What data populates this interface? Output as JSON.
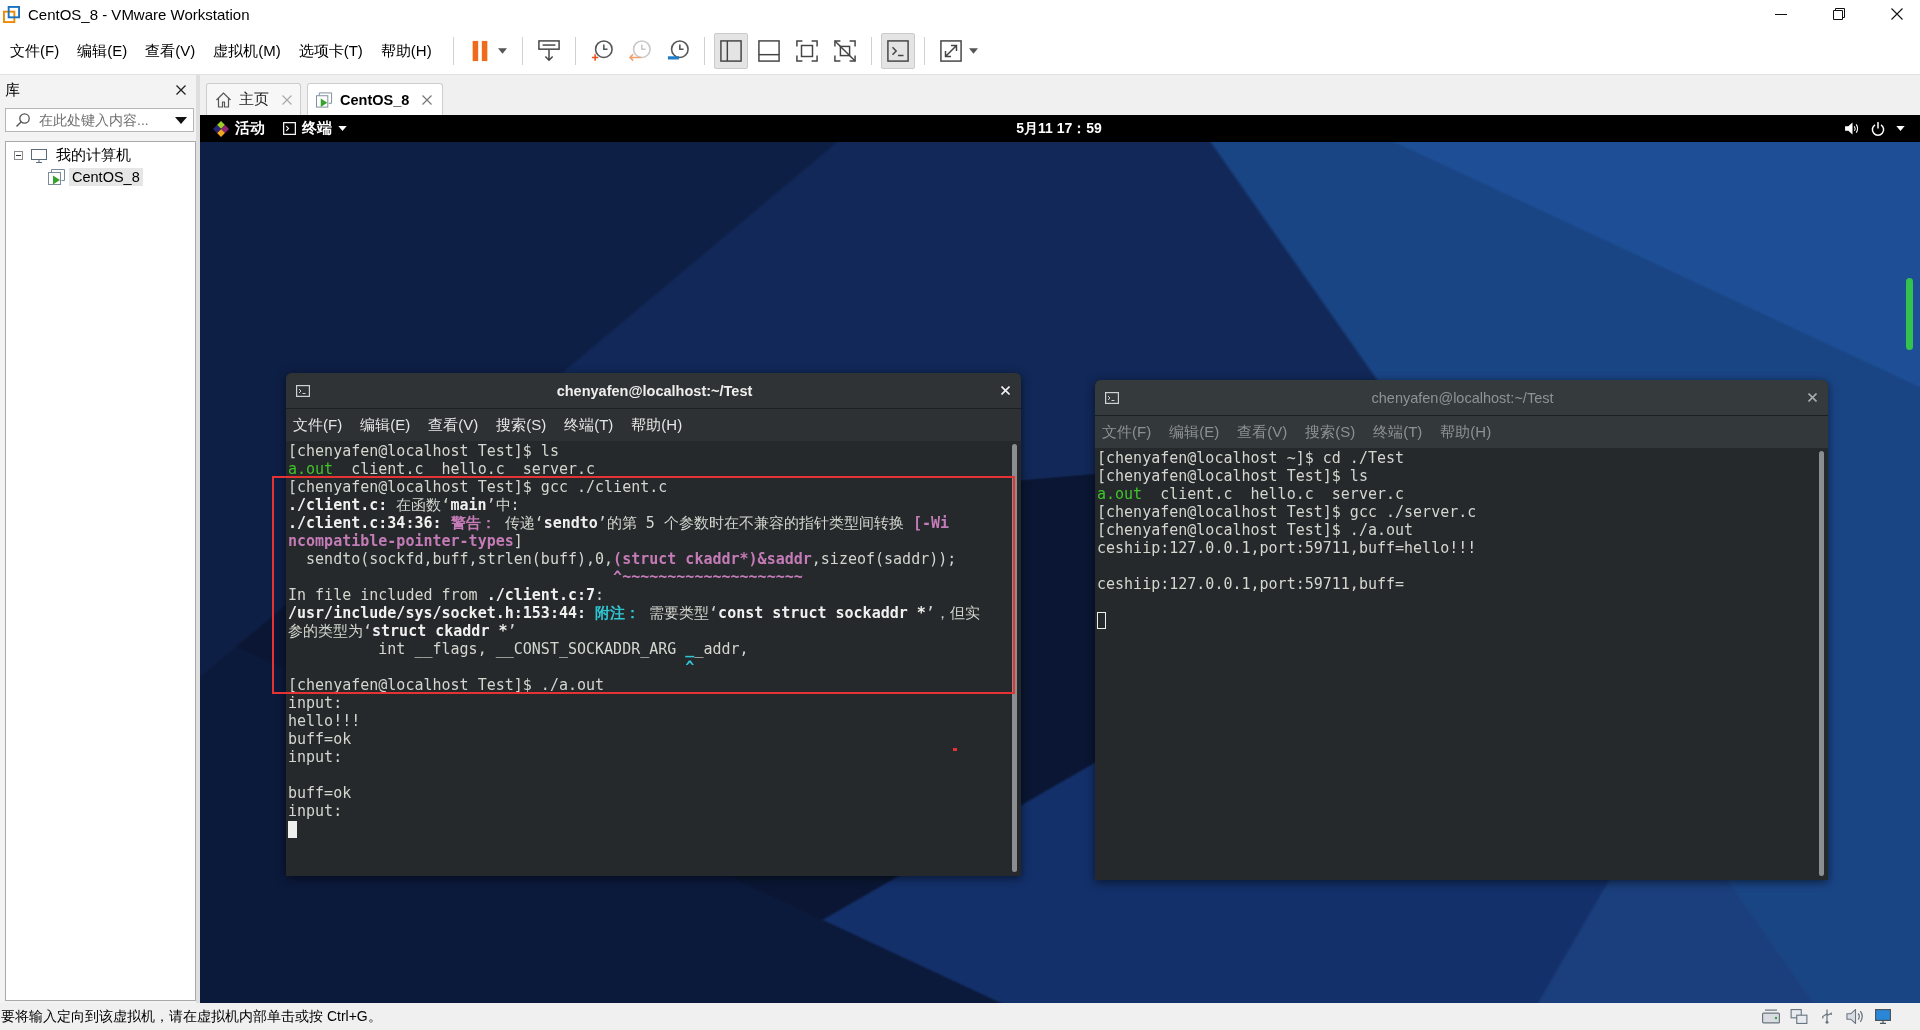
{
  "window": {
    "title": "CentOS_8 - VMware Workstation"
  },
  "menu_bar": [
    "文件(F)",
    "编辑(E)",
    "查看(V)",
    "虚拟机(M)",
    "选项卡(T)",
    "帮助(H)"
  ],
  "toolbar": [
    {
      "pressed": false
    },
    {
      "pressed": false
    },
    {
      "pressed": false
    },
    {
      "pressed": false
    },
    {
      "pressed": false
    },
    {
      "pressed": true
    },
    {
      "pressed": false
    },
    {
      "pressed": false
    },
    {
      "pressed": false
    },
    {
      "pressed": true
    },
    {
      "pressed": false
    }
  ],
  "library": {
    "title": "库",
    "search": {
      "placeholder": "在此处键入内容..."
    },
    "tree": [
      {
        "label": "我的计算机",
        "expanded": true,
        "selected": false,
        "children": [
          {
            "label": "CentOS_8",
            "selected": true
          }
        ]
      }
    ]
  },
  "tabs": [
    {
      "kind": "home",
      "label": "主页",
      "selected": false
    },
    {
      "kind": "vm",
      "label": "CentOS_8",
      "selected": true
    }
  ],
  "guest": {
    "top_bar": {
      "activities": "活动",
      "app_menu": "终端",
      "clock": "5月11 17：59"
    },
    "terminals": [
      {
        "title": "chenyafen@localhost:~/Test",
        "focused": true,
        "menu": [
          "文件(F)",
          "编辑(E)",
          "查看(V)",
          "搜索(S)",
          "终端(T)",
          "帮助(H)"
        ],
        "lines": [
          {
            "kind": "text",
            "spans": [
              {
                "text": "[chenyafen@localhost Test]$ ls",
                "kind": "plain"
              }
            ]
          },
          {
            "kind": "text",
            "spans": [
              {
                "text": "a.out",
                "kind": "executable"
              },
              {
                "text": "  client.c  hello.c  server.c",
                "kind": "plain"
              }
            ]
          },
          {
            "kind": "text",
            "spans": [
              {
                "text": "[chenyafen@localhost Test]$ gcc ./client.c",
                "kind": "plain"
              }
            ]
          },
          {
            "kind": "text",
            "spans": [
              {
                "text": "./client.c:",
                "kind": "bold"
              },
              {
                "text": " 在函数‘",
                "kind": "plain"
              },
              {
                "text": "main",
                "kind": "bold"
              },
              {
                "text": "’中:",
                "kind": "plain"
              }
            ]
          },
          {
            "kind": "text",
            "spans": [
              {
                "text": "./client.c:34:36:",
                "kind": "bold"
              },
              {
                "text": " 警告：",
                "kind": "warning"
              },
              {
                "text": " 传递‘",
                "kind": "plain"
              },
              {
                "text": "sendto",
                "kind": "bold"
              },
              {
                "text": "’的第 5 个参数时在不兼容的指针类型间转换 ",
                "kind": "plain"
              },
              {
                "text": "[-Wi",
                "kind": "warning"
              }
            ]
          },
          {
            "kind": "text",
            "spans": [
              {
                "text": "ncompatible-pointer-types",
                "kind": "warning"
              },
              {
                "text": "]",
                "kind": "plain"
              }
            ]
          },
          {
            "kind": "text",
            "spans": [
              {
                "text": "  sendto(sockfd,buff,strlen(buff),0,",
                "kind": "plain"
              },
              {
                "text": "(struct ckaddr*)&saddr",
                "kind": "warning"
              },
              {
                "text": ",sizeof(saddr));",
                "kind": "plain"
              }
            ]
          },
          {
            "kind": "text",
            "spans": [
              {
                "text": "                                    ^~~~~~~~~~~~~~~~~~~~~",
                "kind": "warning"
              }
            ]
          },
          {
            "kind": "text",
            "spans": [
              {
                "text": "In file included from ",
                "kind": "plain"
              },
              {
                "text": "./client.c:7",
                "kind": "bold"
              },
              {
                "text": ":",
                "kind": "plain"
              }
            ]
          },
          {
            "kind": "text",
            "spans": [
              {
                "text": "/usr/include/sys/socket.h:153:44:",
                "kind": "bold"
              },
              {
                "text": " 附注：",
                "kind": "note"
              },
              {
                "text": " 需要类型‘",
                "kind": "plain"
              },
              {
                "text": "const struct sockaddr *",
                "kind": "bold"
              },
              {
                "text": "’，但实",
                "kind": "plain"
              }
            ]
          },
          {
            "kind": "text",
            "spans": [
              {
                "text": "参的类型为‘",
                "kind": "plain"
              },
              {
                "text": "struct ckaddr *",
                "kind": "bold"
              },
              {
                "text": "’",
                "kind": "plain"
              }
            ]
          },
          {
            "kind": "text",
            "spans": [
              {
                "text": "          int __flags, __CONST_SOCKADDR_ARG ",
                "kind": "plain"
              },
              {
                "text": "_",
                "kind": "note"
              },
              {
                "text": "_addr,",
                "kind": "plain"
              }
            ]
          },
          {
            "kind": "text",
            "spans": [
              {
                "text": "                                            ^",
                "kind": "note"
              }
            ]
          },
          {
            "kind": "text",
            "spans": [
              {
                "text": "[chenyafen@localhost Test]$ ./a.out",
                "kind": "plain"
              }
            ]
          },
          {
            "kind": "text",
            "spans": [
              {
                "text": "input:",
                "kind": "plain"
              }
            ]
          },
          {
            "kind": "text",
            "spans": [
              {
                "text": "hello!!!",
                "kind": "plain"
              }
            ]
          },
          {
            "kind": "text",
            "spans": [
              {
                "text": "buff=ok",
                "kind": "plain"
              }
            ]
          },
          {
            "kind": "text",
            "spans": [
              {
                "text": "input:",
                "kind": "plain"
              }
            ]
          },
          {
            "kind": "blank"
          },
          {
            "kind": "text",
            "spans": [
              {
                "text": "buff=ok",
                "kind": "plain"
              }
            ]
          },
          {
            "kind": "text",
            "spans": [
              {
                "text": "input:",
                "kind": "plain"
              }
            ]
          }
        ]
      },
      {
        "title": "chenyafen@localhost:~/Test",
        "focused": false,
        "menu": [
          "文件(F)",
          "编辑(E)",
          "查看(V)",
          "搜索(S)",
          "终端(T)",
          "帮助(H)"
        ],
        "lines": [
          {
            "kind": "text",
            "spans": [
              {
                "text": "[chenyafen@localhost ~]$ cd ./Test",
                "kind": "plain"
              }
            ]
          },
          {
            "kind": "text",
            "spans": [
              {
                "text": "[chenyafen@localhost Test]$ ls",
                "kind": "plain"
              }
            ]
          },
          {
            "kind": "text",
            "spans": [
              {
                "text": "a.out",
                "kind": "executable"
              },
              {
                "text": "  client.c  hello.c  server.c",
                "kind": "plain"
              }
            ]
          },
          {
            "kind": "text",
            "spans": [
              {
                "text": "[chenyafen@localhost Test]$ gcc ./server.c",
                "kind": "plain"
              }
            ]
          },
          {
            "kind": "text",
            "spans": [
              {
                "text": "[chenyafen@localhost Test]$ ./a.out",
                "kind": "plain"
              }
            ]
          },
          {
            "kind": "text",
            "spans": [
              {
                "text": "ceshiip:127.0.0.1,port:59711,buff=hello!!!",
                "kind": "plain"
              }
            ]
          },
          {
            "kind": "blank"
          },
          {
            "kind": "text",
            "spans": [
              {
                "text": "ceshiip:127.0.0.1,port:59711,buff=",
                "kind": "plain"
              }
            ]
          },
          {
            "kind": "blank"
          }
        ]
      }
    ]
  },
  "status_bar": {
    "message": "要将输入定向到该虚拟机，请在虚拟机内部单击或按 Ctrl+G。"
  }
}
